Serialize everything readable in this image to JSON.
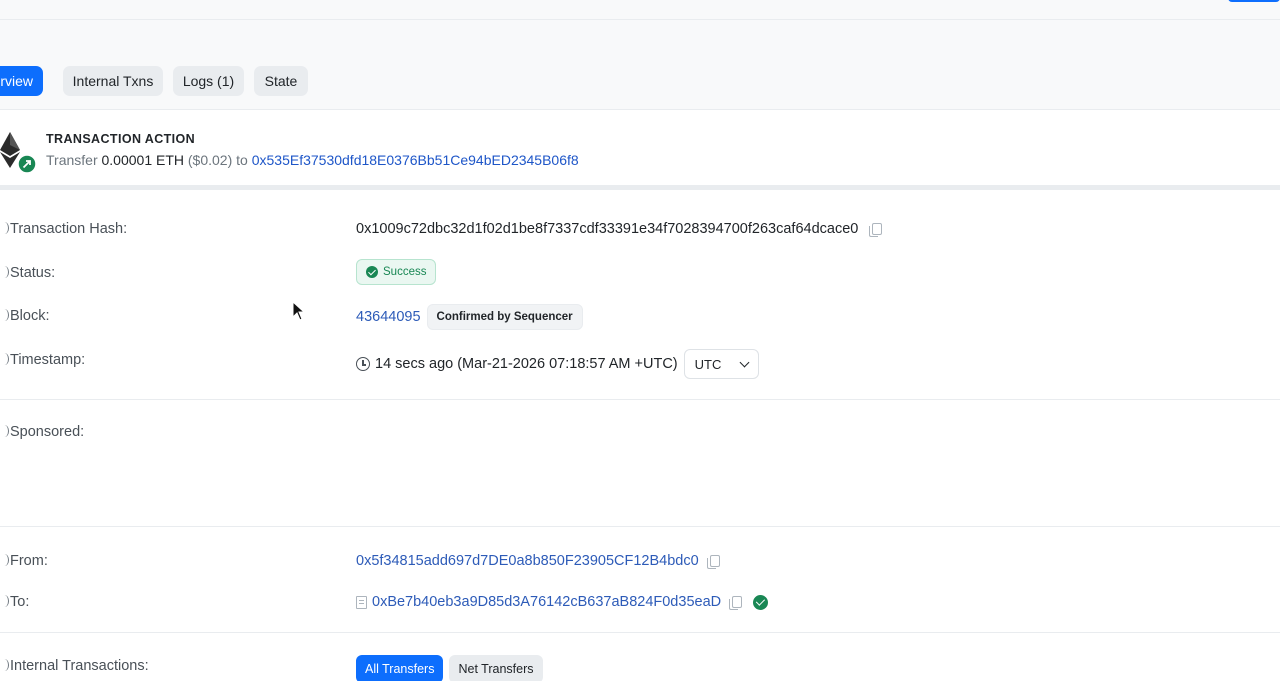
{
  "tabs": [
    {
      "label": "rview",
      "active": true
    },
    {
      "label": "Internal Txns",
      "active": false
    },
    {
      "label": "Logs (1)",
      "active": false
    },
    {
      "label": "State",
      "active": false
    }
  ],
  "action": {
    "title": "TRANSACTION ACTION",
    "prefix": "Transfer",
    "amount": "0.00001 ETH",
    "usd": "($0.02)",
    "to_word": "to",
    "to_address": "0x535Ef37530dfd18E0376Bb51Ce94bED2345B06f8"
  },
  "details": {
    "hash": {
      "label": "Transaction Hash:",
      "value": "0x1009c72dbc32d1f02d1be8f7337cdf33391e34f7028394700f263caf64dcace0"
    },
    "status": {
      "label": "Status:",
      "value": "Success"
    },
    "block": {
      "label": "Block:",
      "number": "43644095",
      "badge": "Confirmed by Sequencer"
    },
    "timestamp": {
      "label": "Timestamp:",
      "value": "14 secs ago (Mar-21-2026 07:18:57 AM +UTC)",
      "timezone": "UTC"
    },
    "sponsored": {
      "label": "Sponsored:"
    },
    "from": {
      "label": "From:",
      "value": "0x5f34815add697d7DE0a8b850F23905CF12B4bdc0"
    },
    "to": {
      "label": "To:",
      "value": "0xBe7b40eb3a9D85d3A76142cB637aB824F0d35eaD"
    },
    "internal": {
      "label": "Internal Transactions:",
      "all": "All Transfers",
      "net": "Net Transfers"
    }
  },
  "colors": {
    "primary": "#0d6efd",
    "success": "#198754",
    "link": "#2d5bb8"
  }
}
